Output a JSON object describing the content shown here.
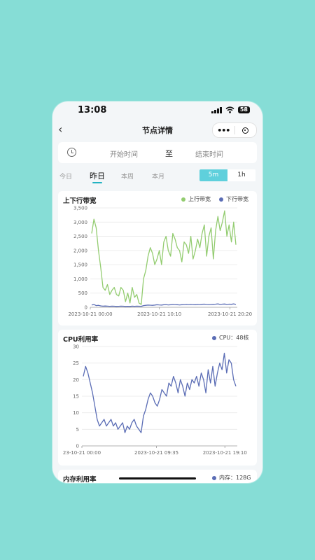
{
  "status_bar": {
    "time": "13:08",
    "battery": "58"
  },
  "nav": {
    "title": "节点详情",
    "back_icon": "‹",
    "more_icon": "•••"
  },
  "date_range": {
    "start": "开始时间",
    "to": "至",
    "end": "结束时间"
  },
  "tabs": [
    {
      "label": "今日",
      "active": false
    },
    {
      "label": "昨日",
      "active": true
    },
    {
      "label": "本周",
      "active": false
    },
    {
      "label": "本月",
      "active": false
    }
  ],
  "interval": {
    "options": [
      "5m",
      "1h"
    ],
    "selected": "5m"
  },
  "colors": {
    "accent": "#5fd0dc",
    "green": "#93cc70",
    "blue": "#5b6db5"
  },
  "cards": {
    "bandwidth": {
      "title": "上下行带宽",
      "legend_up": "上行带宽",
      "legend_down": "下行带宽"
    },
    "cpu": {
      "title": "CPU利用率",
      "legend": "CPU：48核"
    },
    "mem": {
      "title": "内存利用率",
      "legend": "内存：128G"
    }
  },
  "chart_data": [
    {
      "type": "line",
      "title": "上下行带宽",
      "ylim": [
        0,
        3500
      ],
      "yticks": [
        "0",
        "500",
        "1,000",
        "1,500",
        "2,000",
        "2,500",
        "3,000",
        "3,500"
      ],
      "xticks": [
        "2023-10-21 00:00",
        "2023-10-21 10:10",
        "2023-10-21 20:20"
      ],
      "series": [
        {
          "name": "上行带宽",
          "color": "#93cc70",
          "values": [
            2600,
            3100,
            2800,
            2000,
            1400,
            700,
            600,
            800,
            450,
            600,
            700,
            450,
            400,
            700,
            600,
            200,
            500,
            150,
            700,
            350,
            450,
            150,
            100,
            1000,
            1300,
            1800,
            2100,
            1900,
            1500,
            1700,
            2000,
            1500,
            2300,
            2500,
            2000,
            1800,
            2600,
            2400,
            2100,
            2000,
            1600,
            2300,
            2200,
            1900,
            2500,
            1700,
            2000,
            2400,
            2100,
            2600,
            2900,
            1800,
            2500,
            2800,
            1700,
            2700,
            3200,
            2700,
            3000,
            3400,
            2500,
            2900,
            2300,
            3000,
            2200
          ]
        },
        {
          "name": "下行带宽",
          "color": "#5b6db5",
          "values": [
            80,
            100,
            60,
            70,
            50,
            40,
            45,
            40,
            35,
            40,
            38,
            30,
            35,
            40,
            38,
            30,
            35,
            30,
            40,
            35,
            40,
            38,
            35,
            60,
            70,
            80,
            75,
            70,
            80,
            90,
            85,
            80,
            90,
            95,
            85,
            90,
            100,
            95,
            90,
            85,
            90,
            95,
            100,
            95,
            100,
            95,
            90,
            100,
            95,
            105,
            110,
            100,
            95,
            100,
            105,
            110,
            120,
            100,
            110,
            115,
            100,
            110,
            105,
            120,
            100
          ]
        }
      ]
    },
    {
      "type": "line",
      "title": "CPU利用率",
      "ylim": [
        0,
        30
      ],
      "yticks": [
        "0",
        "5",
        "10",
        "15",
        "20",
        "25",
        "30"
      ],
      "xticks": [
        "23-10-21 00:00",
        "2023-10-21 09:35",
        "2023-10-21 19:10"
      ],
      "series": [
        {
          "name": "CPU：48核",
          "color": "#5b6db5",
          "values": [
            21,
            24,
            22,
            19,
            16,
            12,
            8,
            6,
            7,
            8,
            6,
            7,
            8,
            6,
            7,
            5,
            6,
            7,
            4,
            6,
            5,
            7,
            8,
            6,
            5,
            4,
            9,
            11,
            14,
            16,
            15,
            13,
            12,
            14,
            17,
            16,
            15,
            19,
            18,
            21,
            19,
            16,
            20,
            18,
            15,
            19,
            17,
            20,
            19,
            21,
            18,
            22,
            20,
            16,
            23,
            19,
            24,
            18,
            22,
            25,
            23,
            28,
            22,
            26,
            25,
            20,
            18
          ]
        }
      ]
    }
  ]
}
